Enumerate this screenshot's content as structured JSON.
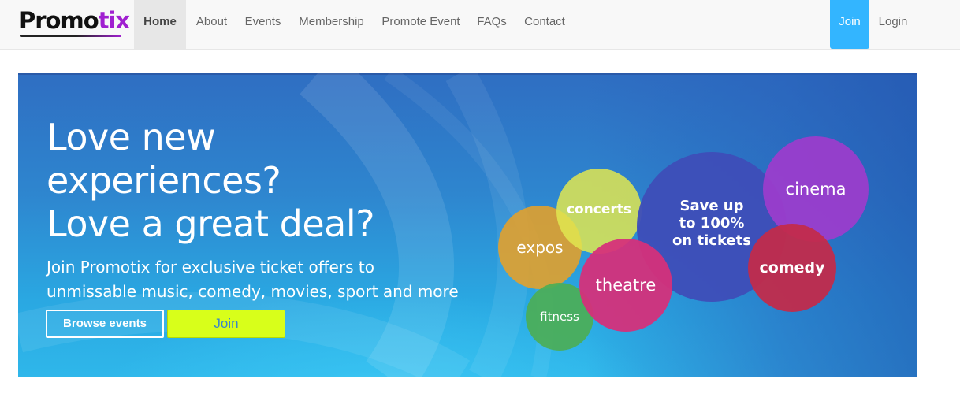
{
  "brand": {
    "name_main": "Promo",
    "name_accent": "tix"
  },
  "nav": {
    "items": [
      {
        "label": "Home",
        "active": true
      },
      {
        "label": "About"
      },
      {
        "label": "Events"
      },
      {
        "label": "Membership"
      },
      {
        "label": "Promote Event"
      },
      {
        "label": "FAQs"
      },
      {
        "label": "Contact"
      }
    ],
    "join_label": "Join",
    "login_label": "Login"
  },
  "hero": {
    "title_lines": [
      "Love new",
      "experiences?",
      "Love a great deal?"
    ],
    "subtitle_lines": [
      "Join Promotix for exclusive ticket offers to",
      "unmissable music, comedy, movies, sport and more"
    ],
    "browse_label": "Browse events",
    "join_label": "Join"
  },
  "bubbles": {
    "expos": "expos",
    "concerts": "concerts",
    "fitness": "fitness",
    "theatre": "theatre",
    "save_lines": [
      "Save up",
      "to 100%",
      "on tickets"
    ],
    "cinema": "cinema",
    "comedy": "comedy"
  },
  "colors": {
    "accent": "#a020d0",
    "nav_join": "#33b5ff",
    "join_button": "#d8ff1a",
    "bubble_expos": "#e0a02a",
    "bubble_concerts": "#d9e04a",
    "bubble_fitness": "#4cae56",
    "bubble_theatre": "#d6307a",
    "bubble_save": "#3e4eb8",
    "bubble_cinema": "#9b3dcc",
    "bubble_comedy": "#c22a4a"
  }
}
